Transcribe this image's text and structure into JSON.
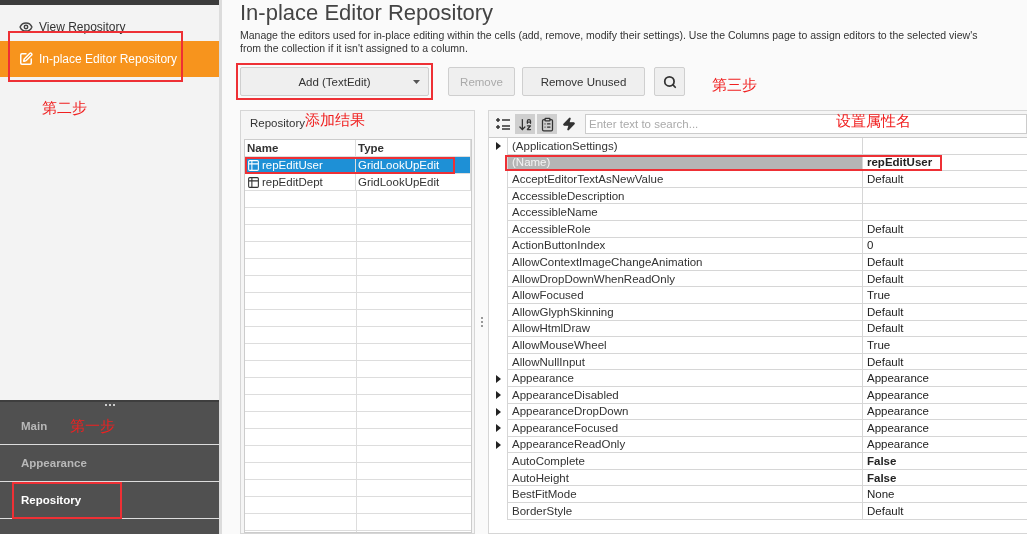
{
  "sidebar": {
    "items": [
      {
        "label": "View Repository",
        "selected": false
      },
      {
        "label": "In-place Editor Repository",
        "selected": true
      }
    ]
  },
  "nav": {
    "items": [
      {
        "label": "Main",
        "selected": false
      },
      {
        "label": "Appearance",
        "selected": false
      },
      {
        "label": "Repository",
        "selected": true
      }
    ]
  },
  "page": {
    "title": "In-place Editor Repository",
    "description": "Manage the editors used for in-place editing within the cells (add, remove, modify their settings). Use the Columns page to assign editors to the selected view's",
    "description_line_2": "from the collection if it isn't assigned to a column."
  },
  "toolbar": {
    "buttons": [
      {
        "label": "Add (TextEdit)",
        "kind": "dropdown",
        "disabled": false
      },
      {
        "label": "Remove",
        "kind": "plain",
        "disabled": true
      },
      {
        "label": "Remove Unused",
        "kind": "plain",
        "disabled": false
      },
      {
        "kind": "search",
        "disabled": false
      }
    ]
  },
  "repository": {
    "title": "Repository",
    "columns": [
      "Name",
      "Type"
    ],
    "rows": [
      {
        "name": "repEditUser",
        "type": "GridLookUpEdit",
        "selected": true
      },
      {
        "name": "repEditDept",
        "type": "GridLookUpEdit",
        "selected": false
      }
    ]
  },
  "property_grid": {
    "search": {
      "placeholder": "Enter text to search..."
    },
    "rows": [
      {
        "name": "(ApplicationSettings)",
        "expandable": true,
        "selected": false
      },
      {
        "name": "(Name)",
        "value": "repEditUser",
        "expandable": false,
        "selected": true,
        "modified": true
      },
      {
        "name": "AcceptEditorTextAsNewValue",
        "value": "Default",
        "expandable": false,
        "selected": false,
        "modified": false
      },
      {
        "name": "AccessibleDescription",
        "expandable": false,
        "selected": false
      },
      {
        "name": "AccessibleName",
        "expandable": false,
        "selected": false
      },
      {
        "name": "AccessibleRole",
        "value": "Default",
        "expandable": false,
        "selected": false,
        "modified": false
      },
      {
        "name": "ActionButtonIndex",
        "value": "0",
        "expandable": false,
        "selected": false,
        "modified": false
      },
      {
        "name": "AllowContextImageChangeAnimation",
        "value": "Default",
        "expandable": false,
        "selected": false,
        "modified": false
      },
      {
        "name": "AllowDropDownWhenReadOnly",
        "value": "Default",
        "expandable": false,
        "selected": false,
        "modified": false
      },
      {
        "name": "AllowFocused",
        "value": "True",
        "expandable": false,
        "selected": false,
        "modified": false
      },
      {
        "name": "AllowGlyphSkinning",
        "value": "Default",
        "expandable": false,
        "selected": false,
        "modified": false
      },
      {
        "name": "AllowHtmlDraw",
        "value": "Default",
        "expandable": false,
        "selected": false,
        "modified": false
      },
      {
        "name": "AllowMouseWheel",
        "value": "True",
        "expandable": false,
        "selected": false,
        "modified": false
      },
      {
        "name": "AllowNullInput",
        "value": "Default",
        "expandable": false,
        "selected": false,
        "modified": false
      },
      {
        "name": "Appearance",
        "value": "Appearance",
        "expandable": true,
        "selected": false,
        "modified": false
      },
      {
        "name": "AppearanceDisabled",
        "value": "Appearance",
        "expandable": true,
        "selected": false,
        "modified": false
      },
      {
        "name": "AppearanceDropDown",
        "value": "Appearance",
        "expandable": true,
        "selected": false,
        "modified": false
      },
      {
        "name": "AppearanceFocused",
        "value": "Appearance",
        "expandable": true,
        "selected": false,
        "modified": false
      },
      {
        "name": "AppearanceReadOnly",
        "value": "Appearance",
        "expandable": true,
        "selected": false,
        "modified": false
      },
      {
        "name": "AutoComplete",
        "value": "False",
        "expandable": false,
        "selected": false,
        "modified": true
      },
      {
        "name": "AutoHeight",
        "value": "False",
        "expandable": false,
        "selected": false,
        "modified": true
      },
      {
        "name": "BestFitMode",
        "value": "None",
        "expandable": false,
        "selected": false,
        "modified": false
      },
      {
        "name": "BorderStyle",
        "value": "Default",
        "expandable": false,
        "selected": false,
        "modified": false
      }
    ]
  },
  "annotations": [
    "第三步",
    "第二步",
    "第一步",
    "添加结果",
    "设置属性名"
  ]
}
